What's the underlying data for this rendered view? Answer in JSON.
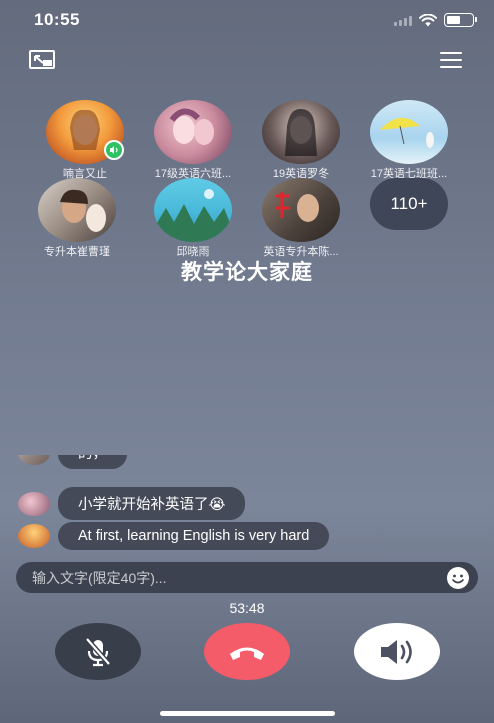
{
  "status_bar": {
    "time": "10:55",
    "icons": [
      "cellular-signal-icon",
      "wifi-icon",
      "battery-icon"
    ]
  },
  "toolbar": {
    "pip_icon": "picture-in-picture-icon",
    "menu_icon": "menu-icon"
  },
  "members": [
    {
      "name": "喃言又止",
      "speaking": true
    },
    {
      "name": "17级英语六班..."
    },
    {
      "name": "19英语罗冬"
    },
    {
      "name": "17英语七班班..."
    },
    {
      "name": "专升本崔曹瑾"
    },
    {
      "name": "邱晓雨"
    },
    {
      "name": "英语专升本陈..."
    }
  ],
  "more_members": "110+",
  "group_title": "教学论大家庭",
  "chat": {
    "messages": [
      {
        "text": "的，"
      },
      {
        "text": "小学就开始补英语了😭"
      },
      {
        "text": "At first, learning English is very hard"
      }
    ]
  },
  "input": {
    "placeholder": "输入文字(限定40字)...",
    "value": ""
  },
  "call": {
    "timer": "53:48",
    "mute_icon": "mic-off-icon",
    "hangup_icon": "hang-up-icon",
    "speaker_icon": "speaker-icon"
  },
  "colors": {
    "hangup": "#f55c6a",
    "speaking_badge": "#2ec265",
    "mute_button": "#393e4b",
    "speaker_button": "#ffffff"
  }
}
